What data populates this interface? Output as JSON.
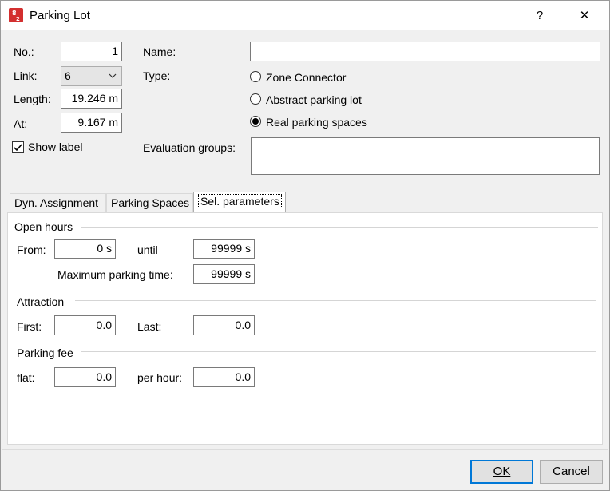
{
  "window": {
    "title": "Parking Lot",
    "help_label": "?",
    "close_label": "✕",
    "app_icon": "parking-lot-app-icon"
  },
  "form": {
    "no_label": "No.:",
    "no_value": "1",
    "link_label": "Link:",
    "link_value": "6",
    "length_label": "Length:",
    "length_value": "19.246 m",
    "at_label": "At:",
    "at_value": "9.167 m",
    "show_label": "Show label",
    "show_label_checked": true,
    "name_label": "Name:",
    "name_value": "",
    "type_label": "Type:",
    "type_options": [
      {
        "label": "Zone Connector",
        "checked": false
      },
      {
        "label": "Abstract parking lot",
        "checked": false
      },
      {
        "label": "Real parking spaces",
        "checked": true
      }
    ],
    "eval_groups_label": "Evaluation groups:",
    "eval_groups_value": ""
  },
  "tabs": [
    {
      "label": "Dyn. Assignment",
      "active": false
    },
    {
      "label": "Parking Spaces",
      "active": false
    },
    {
      "label": "Sel. parameters",
      "active": true
    }
  ],
  "sel_parameters": {
    "open_hours": {
      "title": "Open hours",
      "from_label": "From:",
      "from_value": "0 s",
      "until_label": "until",
      "until_value": "99999 s",
      "max_parking_label": "Maximum parking time:",
      "max_parking_value": "99999 s"
    },
    "attraction": {
      "title": "Attraction",
      "first_label": "First:",
      "first_value": "0.0",
      "last_label": "Last:",
      "last_value": "0.0"
    },
    "parking_fee": {
      "title": "Parking fee",
      "flat_label": "flat:",
      "flat_value": "0.0",
      "per_hour_label": "per hour:",
      "per_hour_value": "0.0"
    }
  },
  "buttons": {
    "ok": "OK",
    "cancel": "Cancel"
  },
  "colors": {
    "accent": "#0078d7",
    "dialog_bg": "#f0f0f0",
    "icon_red": "#d32f2f"
  }
}
